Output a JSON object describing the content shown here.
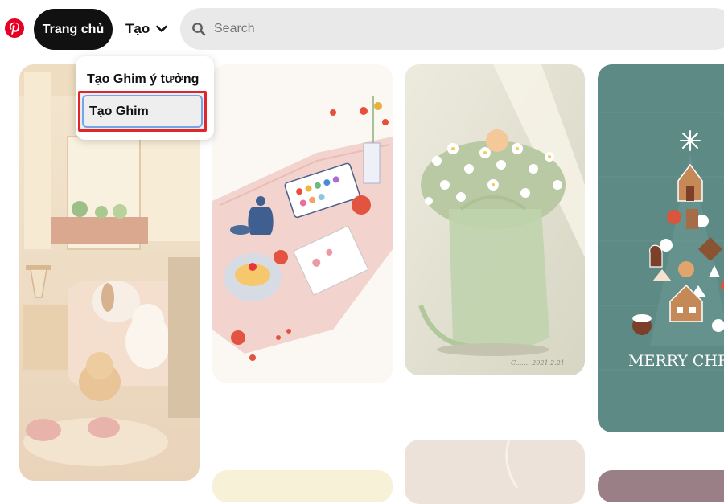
{
  "header": {
    "logo": "pinterest-logo",
    "home_label": "Trang chủ",
    "create_label": "Tạo",
    "create_icon": "chevron-down-icon",
    "search_placeholder": "Search",
    "search_icon": "search-icon"
  },
  "dropdown": {
    "items": [
      {
        "label": "Tạo Ghim ý tưởng"
      },
      {
        "label": "Tạo Ghim",
        "highlighted": true
      }
    ]
  },
  "pins": [
    {
      "name": "cozy-room-illustration"
    },
    {
      "name": "tea-picnic-illustration"
    },
    {
      "name": "daisy-bag-illustration",
      "signature_visible": true
    },
    {
      "name": "christmas-tree-card",
      "caption": "MERRY CHRISTMAS"
    },
    {
      "name": "pin-cream-partial"
    },
    {
      "name": "pin-beige-partial"
    },
    {
      "name": "pin-mauve-partial"
    }
  ],
  "colors": {
    "brand": "#e60023",
    "home_bg": "#111111",
    "search_bg": "#e9e9e9",
    "highlight_border": "#e0262b",
    "focus_ring": "#74a4ea"
  }
}
